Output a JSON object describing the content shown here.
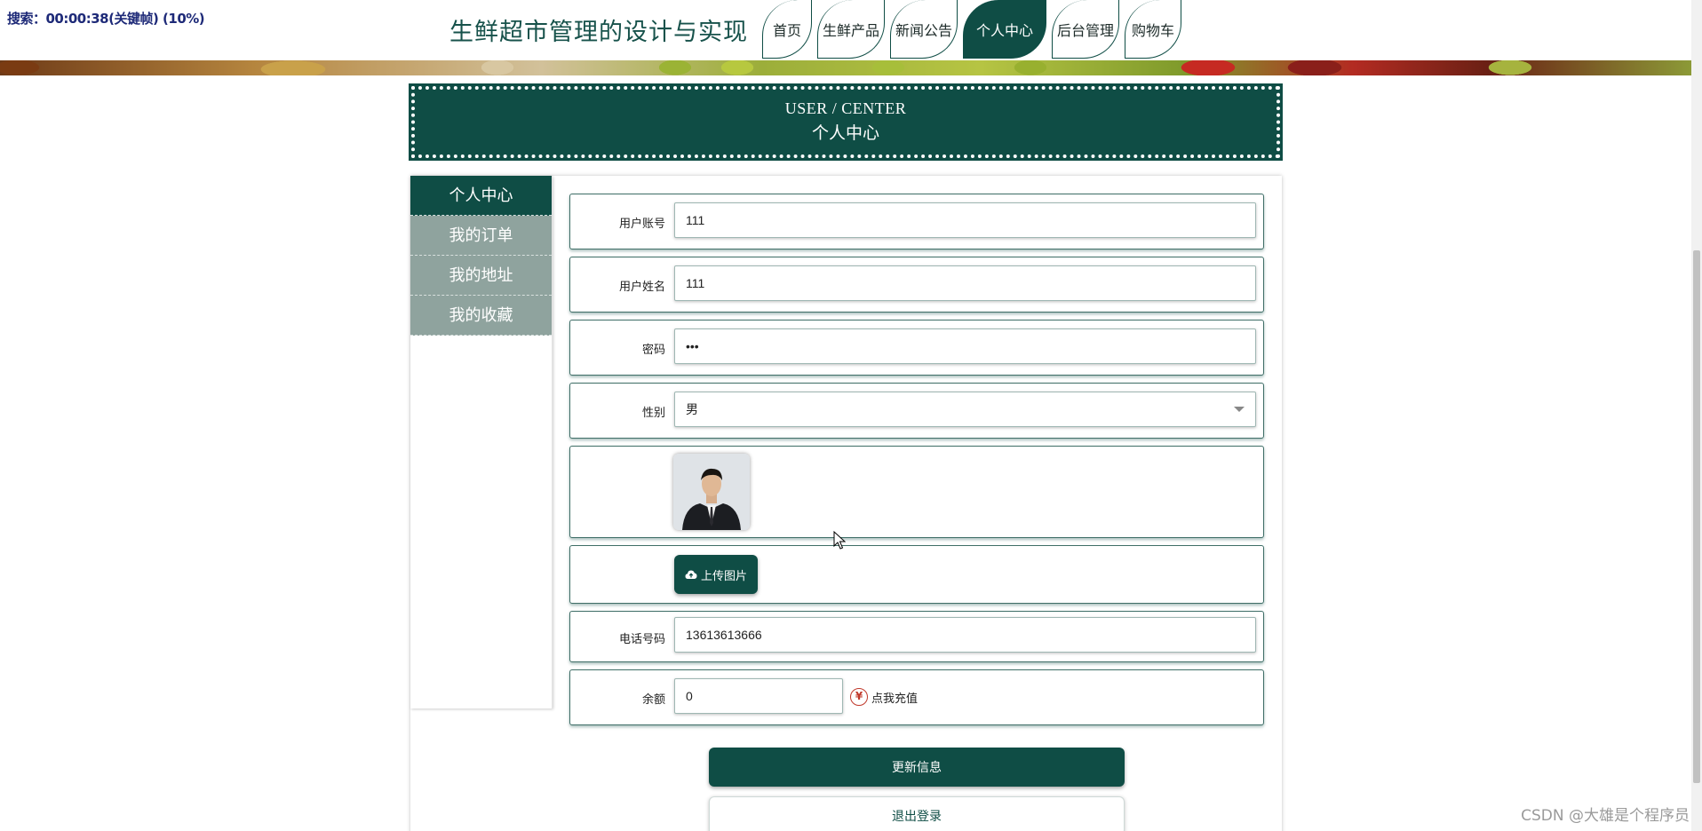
{
  "overlay": {
    "text": "搜索：00:00:38(关键帧) (10%)"
  },
  "header": {
    "site_title": "生鲜超市管理的设计与实现",
    "nav": [
      {
        "label": "首页",
        "active": false
      },
      {
        "label": "生鲜产品",
        "active": false
      },
      {
        "label": "新闻公告",
        "active": false
      },
      {
        "label": "个人中心",
        "active": true
      },
      {
        "label": "后台管理",
        "active": false
      },
      {
        "label": "购物车",
        "active": false
      }
    ]
  },
  "page_header": {
    "en": "USER / CENTER",
    "cn": "个人中心"
  },
  "sidebar": {
    "items": [
      {
        "label": "个人中心",
        "active": true
      },
      {
        "label": "我的订单",
        "active": false
      },
      {
        "label": "我的地址",
        "active": false
      },
      {
        "label": "我的收藏",
        "active": false
      }
    ]
  },
  "form": {
    "account": {
      "label": "用户账号",
      "value": "111"
    },
    "name": {
      "label": "用户姓名",
      "value": "111"
    },
    "password": {
      "label": "密码",
      "value": "•••"
    },
    "gender": {
      "label": "性别",
      "value": "男"
    },
    "avatar": {
      "icon": "user-photo"
    },
    "upload": {
      "label": "上传图片",
      "icon": "cloud-upload-icon"
    },
    "phone": {
      "label": "电话号码",
      "value": "13613613666"
    },
    "balance": {
      "label": "余额",
      "value": "0",
      "recharge_label": "点我充值",
      "recharge_icon": "yen-icon"
    }
  },
  "buttons": {
    "update": "更新信息",
    "logout": "退出登录"
  },
  "watermark": "CSDN @大雄是个程序员",
  "colors": {
    "primary": "#0f4d45",
    "sidebar_inactive": "#8fa39e"
  }
}
